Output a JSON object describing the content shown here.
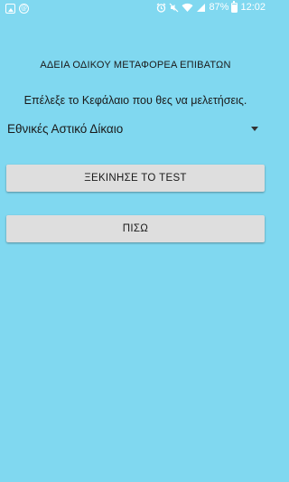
{
  "status_bar": {
    "notification_icon_1": "image-icon",
    "notification_icon_2": "at-sign-icon",
    "at_glyph": "@",
    "battery_percent": "87%",
    "time": "12:02"
  },
  "main": {
    "title": "ΑΔΕΙΑ ΟΔΙΚΟΥ ΜΕΤΑΦΟΡΕΑ ΕΠΙΒΑΤΩΝ",
    "prompt": "Επέλεξε το Κεφάλαιο που θες να μελετήσεις.",
    "chapter_selected": "Εθνικές Αστικό Δίκαιο",
    "start_button": "ΞΕΚΙΝΗΣΕ ΤΟ TEST",
    "back_button": "ΠΙΣΩ"
  },
  "colors": {
    "background": "#80d8f0",
    "button": "#dedede"
  }
}
